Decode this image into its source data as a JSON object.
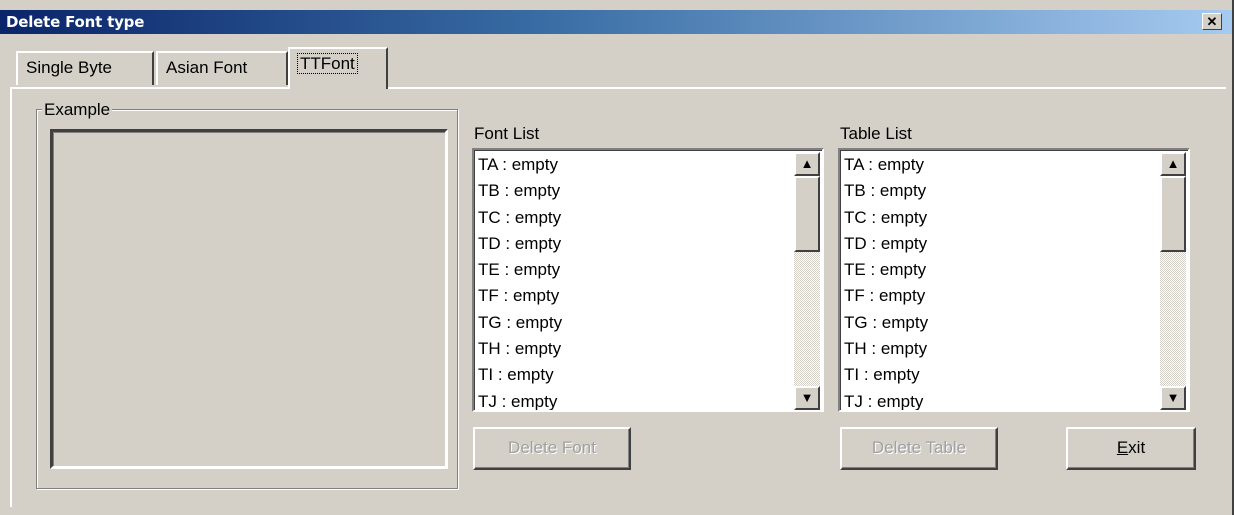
{
  "window": {
    "title": "Delete Font type",
    "close_glyph": "✕"
  },
  "tabs": [
    {
      "label": "Single Byte"
    },
    {
      "label": "Asian Font"
    },
    {
      "label": "TTFont",
      "active": true
    }
  ],
  "example": {
    "legend": "Example"
  },
  "font_list": {
    "label": "Font List",
    "items": [
      "TA : empty",
      "TB : empty",
      "TC : empty",
      "TD : empty",
      "TE : empty",
      "TF : empty",
      "TG : empty",
      "TH : empty",
      "TI : empty",
      "TJ : empty"
    ],
    "delete_button": "Delete Font"
  },
  "table_list": {
    "label": "Table List",
    "items": [
      "TA : empty",
      "TB : empty",
      "TC : empty",
      "TD : empty",
      "TE : empty",
      "TF : empty",
      "TG : empty",
      "TH : empty",
      "TI : empty",
      "TJ : empty"
    ],
    "delete_button": "Delete Table"
  },
  "exit_button": {
    "mnemonic": "E",
    "rest": "xit"
  },
  "icons": {
    "scroll_up": "up-arrow-icon",
    "scroll_down": "down-arrow-icon",
    "close": "close-icon"
  }
}
